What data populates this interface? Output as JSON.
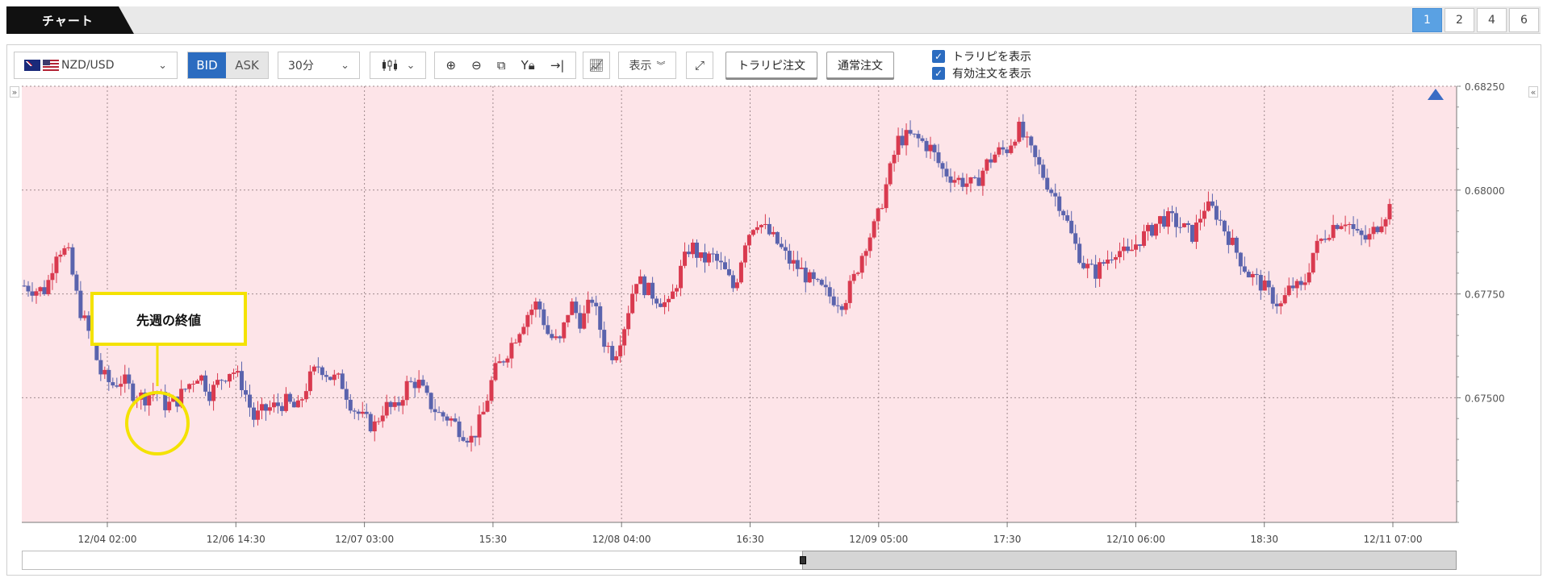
{
  "tab": {
    "label": "チャート"
  },
  "layout_pages": [
    "1",
    "2",
    "4",
    "6"
  ],
  "active_layout_page": "1",
  "toolbar": {
    "symbol": "NZD/USD",
    "bid": "BID",
    "ask": "ASK",
    "interval": "30分",
    "display": "表示",
    "tralipi_order": "トラリピ注文",
    "normal_order": "通常注文",
    "show_tralipi": "トラリピを表示",
    "show_active_orders": "有効注文を表示"
  },
  "annotation": {
    "text": "先週の終値"
  },
  "colors": {
    "up": "#d93a4f",
    "down": "#5a63ad",
    "plot_bg": "#fde4e8",
    "accent": "#2b6cc0",
    "highlight": "#f4e200"
  },
  "chart_data": {
    "type": "candlestick",
    "symbol": "NZD/USD",
    "interval": "30分",
    "ylim": [
      0.672,
      0.6825
    ],
    "y_ticks": [
      "0.67500",
      "0.67750",
      "0.68000",
      "0.68250"
    ],
    "x_ticks": [
      "12/04 02:00",
      "12/06 14:30",
      "12/07 03:00",
      "15:30",
      "12/08 04:00",
      "16:30",
      "12/09 05:00",
      "17:30",
      "12/10 06:00",
      "18:30",
      "12/11 07:00"
    ],
    "close_path": [
      0.6777,
      0.6776,
      0.6776,
      0.6786,
      0.6785,
      0.6772,
      0.6765,
      0.6756,
      0.6753,
      0.67545,
      0.6751,
      0.675,
      0.6752,
      0.6748,
      0.67495,
      0.6753,
      0.6756,
      0.6751,
      0.67545,
      0.6757,
      0.6753,
      0.6745,
      0.6747,
      0.6748,
      0.6749,
      0.6747,
      0.6754,
      0.6758,
      0.6755,
      0.6754,
      0.6748,
      0.6745,
      0.6743,
      0.6748,
      0.6747,
      0.6753,
      0.6754,
      0.6749,
      0.6746,
      0.6745,
      0.6742,
      0.674,
      0.6746,
      0.6756,
      0.676,
      0.6765,
      0.677,
      0.6773,
      0.6765,
      0.6763,
      0.6773,
      0.6768,
      0.6774,
      0.6764,
      0.676,
      0.6768,
      0.6779,
      0.6776,
      0.6774,
      0.6772,
      0.678,
      0.6787,
      0.6783,
      0.6784,
      0.6781,
      0.6776,
      0.6788,
      0.6793,
      0.679,
      0.6787,
      0.6783,
      0.6781,
      0.6778,
      0.6776,
      0.6774,
      0.6773,
      0.6779,
      0.6787,
      0.6792,
      0.6802,
      0.6812,
      0.6813,
      0.6812,
      0.681,
      0.6805,
      0.6803,
      0.6802,
      0.6801,
      0.6806,
      0.6809,
      0.681,
      0.6815,
      0.681,
      0.6805,
      0.68,
      0.6796,
      0.6788,
      0.6782,
      0.678,
      0.6783,
      0.6786,
      0.6784,
      0.6788,
      0.679,
      0.6793,
      0.6793,
      0.6791,
      0.6789,
      0.6796,
      0.6795,
      0.679,
      0.6785,
      0.678,
      0.6778,
      0.6775,
      0.6772,
      0.6777,
      0.6776,
      0.6785,
      0.6789,
      0.6792,
      0.6793,
      0.6789,
      0.6788,
      0.6792,
      0.6796
    ],
    "annotations": [
      "先週の終値"
    ]
  }
}
